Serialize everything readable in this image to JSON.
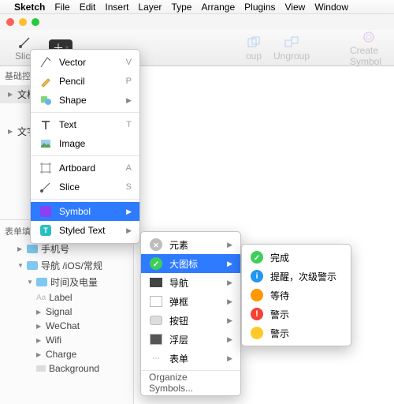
{
  "menubar": {
    "app": "Sketch",
    "items": [
      "File",
      "Edit",
      "Insert",
      "Layer",
      "Type",
      "Arrange",
      "Plugins",
      "View",
      "Window"
    ]
  },
  "toolbar": {
    "slice": "Slice",
    "group": "oup",
    "ungroup": "Ungroup",
    "createSymbol": "Create Symbol"
  },
  "sidebar": {
    "title": "基础控",
    "pages": [
      "文档",
      "文字"
    ],
    "section": "表单填写页面",
    "items": [
      "手机号",
      "导航 /iOS/常规",
      "时间及电量",
      "Label",
      "Signal",
      "WeChat",
      "Wifi",
      "Charge",
      "Background"
    ]
  },
  "menu1": {
    "vector": {
      "label": "Vector",
      "key": "V"
    },
    "pencil": {
      "label": "Pencil",
      "key": "P"
    },
    "shape": {
      "label": "Shape"
    },
    "text": {
      "label": "Text",
      "key": "T"
    },
    "image": {
      "label": "Image"
    },
    "artboard": {
      "label": "Artboard",
      "key": "A"
    },
    "slice": {
      "label": "Slice",
      "key": "S"
    },
    "symbol": {
      "label": "Symbol"
    },
    "styled": {
      "label": "Styled Text"
    }
  },
  "menu2": {
    "yuansu": "元素",
    "datubiao": "大图标",
    "daohang": "导航",
    "tankuang": "弹框",
    "anniu": "按钮",
    "fuceng": "浮层",
    "biaodan": "表单",
    "organize": "Organize Symbols..."
  },
  "menu3": {
    "wancheng": "完成",
    "tixing": "提醒，次级警示",
    "dengdai": "等待",
    "jingshi1": "警示",
    "jingshi2": "警示"
  }
}
